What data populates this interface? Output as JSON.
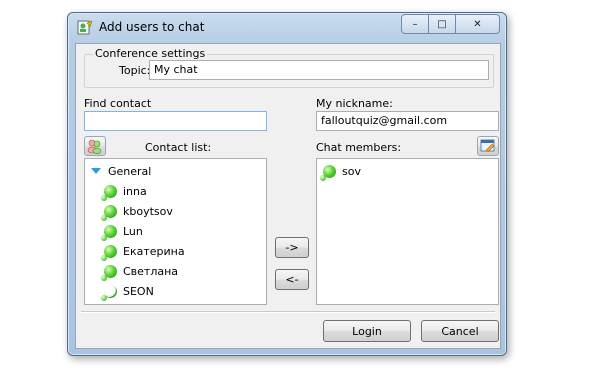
{
  "window": {
    "title": "Add users to chat"
  },
  "titlebar_buttons": {
    "minimize": "–",
    "maximize": "□",
    "close": "✕"
  },
  "conference": {
    "group_label": "Conference settings",
    "topic_label": "Topic:",
    "topic_value": "My chat"
  },
  "find_contact": {
    "label": "Find contact",
    "value": ""
  },
  "nickname": {
    "label": "My nickname:",
    "value": "falloutquiz@gmail.com"
  },
  "contact_list": {
    "label": "Contact list:",
    "group": "General",
    "items": [
      {
        "name": "inna",
        "status": "online"
      },
      {
        "name": "kboytsov",
        "status": "online"
      },
      {
        "name": "Lun",
        "status": "online"
      },
      {
        "name": "Екатерина",
        "status": "online"
      },
      {
        "name": "Светлана",
        "status": "online"
      },
      {
        "name": "SEON",
        "status": "offline"
      }
    ]
  },
  "chat_members": {
    "label": "Chat members:",
    "items": [
      {
        "name": "sov",
        "status": "online"
      }
    ]
  },
  "move_buttons": {
    "add": "->",
    "remove": "<-"
  },
  "footer": {
    "login": "Login",
    "cancel": "Cancel"
  },
  "colors": {
    "accent": "#2f9bd8",
    "online": "#5bd23a",
    "frame": "#aac3df"
  },
  "icons": {
    "app": "chat-app-icon",
    "contacts_button": "contacts-icon",
    "members_button": "edit-members-icon"
  }
}
